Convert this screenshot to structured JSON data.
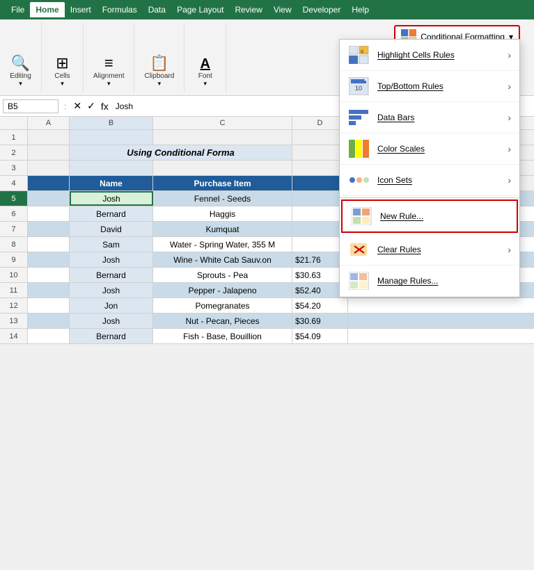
{
  "menubar": {
    "items": [
      "File",
      "Home",
      "Insert",
      "Formulas",
      "Data",
      "Page Layout",
      "Review",
      "View",
      "Developer",
      "Help"
    ],
    "active": "Home"
  },
  "ribbon": {
    "groups": [
      {
        "id": "editing",
        "label": "Editing",
        "icon": "🔍"
      },
      {
        "id": "cells",
        "label": "Cells",
        "icon": "⊞"
      },
      {
        "id": "alignment",
        "label": "Alignment",
        "icon": "≡"
      },
      {
        "id": "clipboard",
        "label": "Clipboard",
        "icon": "📋"
      },
      {
        "id": "font",
        "label": "Font",
        "icon": "A"
      }
    ],
    "cf_button_label": "Conditional Formatting",
    "cf_dropdown_icon": "▾"
  },
  "dropdown": {
    "items": [
      {
        "id": "highlight",
        "label": "Highlight Cells Rules",
        "has_arrow": true,
        "icon_type": "highlight"
      },
      {
        "id": "topbottom",
        "label": "Top/Bottom Rules",
        "has_arrow": true,
        "icon_type": "topbottom"
      },
      {
        "id": "databars",
        "label": "Data Bars",
        "has_arrow": true,
        "icon_type": "databars"
      },
      {
        "id": "colorscales",
        "label": "Color Scales",
        "has_arrow": true,
        "icon_type": "colorscales"
      },
      {
        "id": "iconsets",
        "label": "Icon Sets",
        "has_arrow": true,
        "icon_type": "iconsets"
      },
      {
        "id": "newrule",
        "label": "New Rule...",
        "has_arrow": false,
        "icon_type": "newrule",
        "highlighted": true
      },
      {
        "id": "clearrules",
        "label": "Clear Rules",
        "has_arrow": true,
        "icon_type": "clear"
      },
      {
        "id": "managerules",
        "label": "Manage Rules...",
        "has_arrow": false,
        "icon_type": "manage"
      }
    ]
  },
  "formula_bar": {
    "cell_ref": "B5",
    "value": "Josh"
  },
  "spreadsheet": {
    "title": "Using Conditional Forma",
    "col_headers": [
      "A",
      "B",
      "C",
      "D"
    ],
    "row_headers": [
      "1",
      "2",
      "3",
      "4",
      "5",
      "6",
      "7",
      "8",
      "9",
      "10",
      "11",
      "12",
      "13",
      "14"
    ],
    "headers": [
      "Name",
      "Purchase Item",
      ""
    ],
    "rows": [
      {
        "num": 5,
        "a": "Josh",
        "b": "Fennel - Seeds",
        "c": "",
        "type": "teal",
        "selected": true
      },
      {
        "num": 6,
        "a": "Bernard",
        "b": "Haggis",
        "c": "",
        "type": "white"
      },
      {
        "num": 7,
        "a": "David",
        "b": "Kumquat",
        "c": "",
        "type": "teal"
      },
      {
        "num": 8,
        "a": "Sam",
        "b": "Water - Spring Water, 355 M",
        "c": "",
        "type": "white"
      },
      {
        "num": 9,
        "a": "Josh",
        "b": "Wine - White Cab Sauv.on",
        "c": "$21.76",
        "type": "teal"
      },
      {
        "num": 10,
        "a": "Bernard",
        "b": "Sprouts - Pea",
        "c": "$30.63",
        "type": "white"
      },
      {
        "num": 11,
        "a": "Josh",
        "b": "Pepper - Jalapeno",
        "c": "$52.40",
        "type": "teal"
      },
      {
        "num": 12,
        "a": "Jon",
        "b": "Pomegranates",
        "c": "$54.20",
        "type": "white"
      },
      {
        "num": 13,
        "a": "Josh",
        "b": "Nut - Pecan, Pieces",
        "c": "$30.69",
        "type": "teal"
      },
      {
        "num": 14,
        "a": "Bernard",
        "b": "Fish - Base, Bouillion",
        "c": "$54.09",
        "type": "white"
      }
    ]
  }
}
